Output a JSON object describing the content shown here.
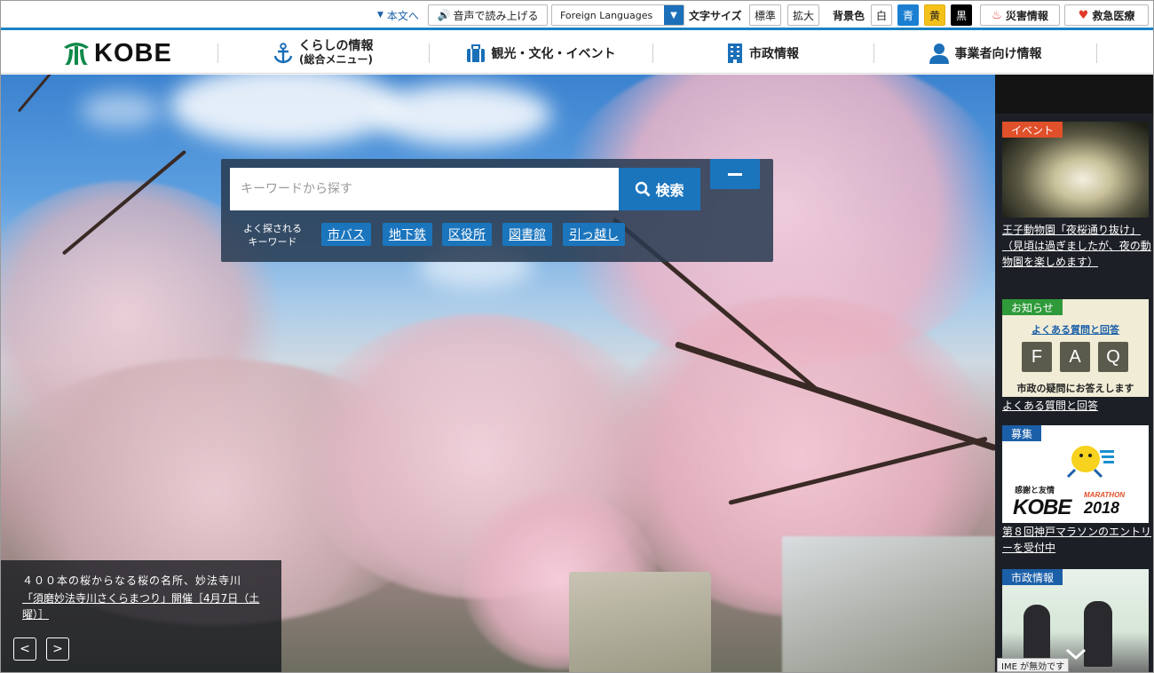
{
  "utility": {
    "skip_link": "本文へ",
    "voice": "音声で読み上げる",
    "language_select": "Foreign Languages",
    "font_size_label": "文字サイズ",
    "font_standard": "標準",
    "font_large": "拡大",
    "bg_color_label": "背景色",
    "bg_white": "白",
    "bg_blue": "青",
    "bg_yellow": "黄",
    "bg_black": "黒",
    "disaster": "災害情報",
    "emergency": "救急医療"
  },
  "logo": {
    "text": "KOBE"
  },
  "nav": [
    {
      "label": "くらしの情報",
      "sub": "(総合メニュー)",
      "icon": "anchor-icon"
    },
    {
      "label": "観光・文化・イベント",
      "icon": "suitcase-icon"
    },
    {
      "label": "市政情報",
      "icon": "building-icon"
    },
    {
      "label": "事業者向け情報",
      "icon": "person-icon"
    }
  ],
  "search": {
    "placeholder": "キーワードから探す",
    "button": "検索",
    "keywords_label": "よく探される キーワード",
    "keywords": [
      "市バス",
      "地下鉄",
      "区役所",
      "図書館",
      "引っ越し"
    ]
  },
  "hero_caption": {
    "line1": "４００本の桜からなる桜の名所、妙法寺川",
    "link": "「須磨妙法寺川さくらまつり」開催［4月7日（土曜）］"
  },
  "side": [
    {
      "tag": "イベント",
      "tag_color": "#e0502a",
      "caption": "王子動物園「夜桜通り抜け」（見頃は過ぎましたが、夜の動物園を楽しめます）"
    },
    {
      "tag": "お知らせ",
      "tag_color": "#2f9a3a",
      "faq_top": "よくある質問と回答",
      "faq_letters": [
        "F",
        "A",
        "Q"
      ],
      "faq_bottom": "市政の疑問にお答えします",
      "caption": "よくある質問と回答"
    },
    {
      "tag": "募集",
      "tag_color": "#1b5fa8",
      "banner_small": "感謝と友情",
      "banner_big": "KOBE",
      "banner_marathon": "MARATHON",
      "banner_year": "2018",
      "caption": "第８回神戸マラソンのエントリーを受付中"
    },
    {
      "tag": "市政情報",
      "tag_color": "#1b5fa8"
    }
  ],
  "ime": "IME が無効です"
}
